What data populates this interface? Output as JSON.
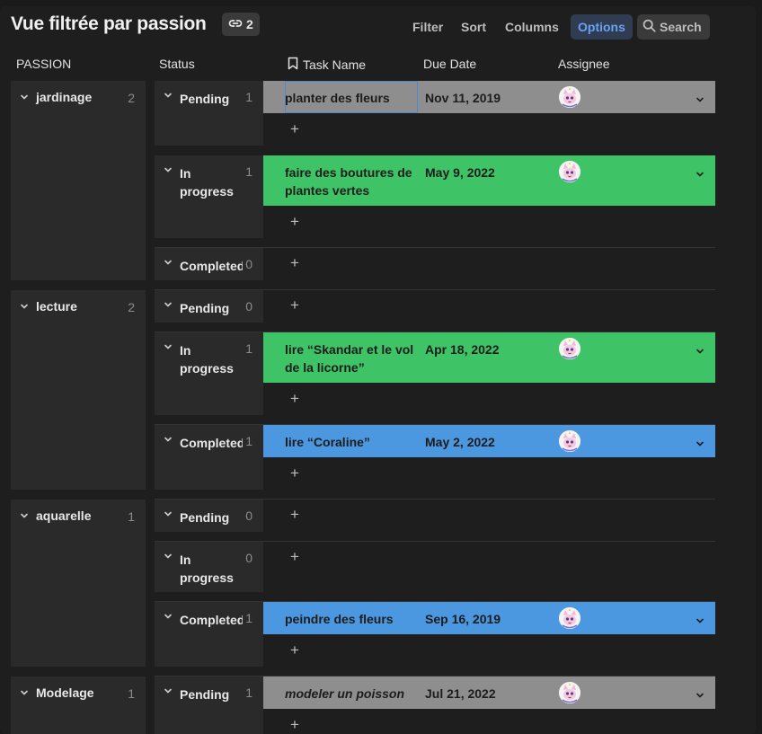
{
  "header": {
    "title": "Vue filtrée par passion",
    "link_count": "2",
    "toolbar": {
      "filter": "Filter",
      "sort": "Sort",
      "columns": "Columns",
      "options": "Options",
      "search": "Search"
    }
  },
  "columns": {
    "passion": "PASSION",
    "status": "Status",
    "task_name": "Task Name",
    "due_date": "Due Date",
    "assignee": "Assignee"
  },
  "groups": [
    {
      "name": "jardinage",
      "count": "2",
      "statuses": [
        {
          "label": "Pending",
          "count": "1",
          "task": "planter des fleurs",
          "due": "Nov 11, 2019"
        },
        {
          "label": "In progress",
          "count": "1",
          "task": "faire des boutures de plantes vertes",
          "due": "May 9, 2022"
        },
        {
          "label": "Completed",
          "count": "0"
        }
      ]
    },
    {
      "name": "lecture",
      "count": "2",
      "statuses": [
        {
          "label": "Pending",
          "count": "0"
        },
        {
          "label": "In progress",
          "count": "1",
          "task": "lire “Skandar et le vol de la licorne”",
          "due": "Apr 18, 2022"
        },
        {
          "label": "Completed",
          "count": "1",
          "task": "lire “Coraline”",
          "due": "May 2, 2022"
        }
      ]
    },
    {
      "name": "aquarelle",
      "count": "1",
      "statuses": [
        {
          "label": "Pending",
          "count": "0"
        },
        {
          "label": "In progress",
          "count": "0"
        },
        {
          "label": "Completed",
          "count": "1",
          "task": "peindre des fleurs",
          "due": "Sep 16, 2019"
        }
      ]
    },
    {
      "name": "Modelage",
      "count": "1",
      "statuses": [
        {
          "label": "Pending",
          "count": "1",
          "task": "modeler un poisson",
          "due": "Jul 21, 2022"
        }
      ]
    }
  ],
  "add_symbol": "+",
  "colors": {
    "pending": "#8e8e8e",
    "in_progress": "#3ec466",
    "completed": "#4b98e0",
    "accent": "#6aa2f0"
  }
}
